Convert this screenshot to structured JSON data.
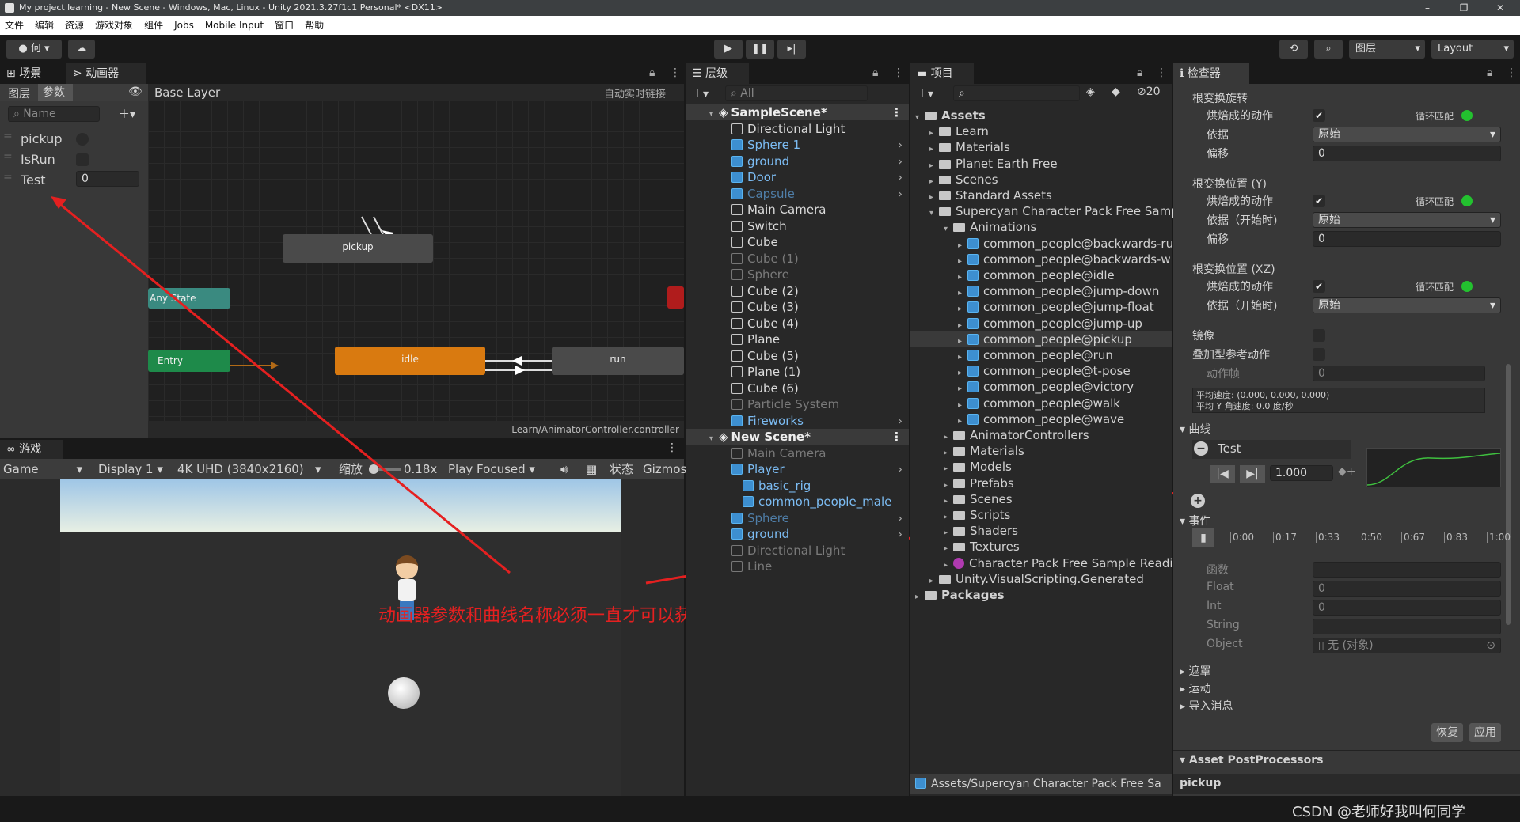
{
  "window": {
    "title": "My project learning - New Scene - Windows, Mac, Linux - Unity 2021.3.27f1c1 Personal* <DX11>"
  },
  "menu": [
    "文件",
    "编辑",
    "资源",
    "游戏对象",
    "组件",
    "Jobs",
    "Mobile Input",
    "窗口",
    "帮助"
  ],
  "toolbar": {
    "account": "何",
    "layers": "图层",
    "layout": "Layout"
  },
  "animator": {
    "tab_scene": "场景",
    "tab_animator": "动画器",
    "sub_layers": "图层",
    "sub_params": "参数",
    "breadcrumb": "Base Layer",
    "live_link": "自动实时链接",
    "search_placeholder": "Name",
    "params": [
      {
        "name": "pickup",
        "value": ""
      },
      {
        "name": "IsRun",
        "value": ""
      },
      {
        "name": "Test",
        "value": "0"
      }
    ],
    "nodes": {
      "pickup": "pickup",
      "any": "Any State",
      "entry": "Entry",
      "idle": "idle",
      "run": "run"
    },
    "footer": "Learn/AnimatorController.controller"
  },
  "game": {
    "tab": "游戏",
    "game": "Game",
    "display": "Display 1",
    "resolution": "4K UHD (3840x2160)",
    "scale_label": "缩放",
    "scale": "0.18x",
    "play_mode": "Play Focused",
    "stats": "状态",
    "gizmos": "Gizmos"
  },
  "annotation": "动画器参数和曲线名称必须一直才可以获取信息",
  "hierarchy": {
    "tab": "层级",
    "search_placeholder": "All",
    "scene1": "SampleScene*",
    "items1": [
      {
        "label": "Directional Light",
        "style": "white"
      },
      {
        "label": "Sphere 1",
        "style": "blue"
      },
      {
        "label": "ground",
        "style": "blue"
      },
      {
        "label": "Door",
        "style": "blue"
      },
      {
        "label": "Capsule",
        "style": "dimblue"
      },
      {
        "label": "Main Camera",
        "style": "white"
      },
      {
        "label": "Switch",
        "style": "white"
      },
      {
        "label": "Cube",
        "style": "white"
      },
      {
        "label": "Cube (1)",
        "style": "dim"
      },
      {
        "label": "Sphere",
        "style": "dim"
      },
      {
        "label": "Cube (2)",
        "style": "white"
      },
      {
        "label": "Cube (3)",
        "style": "white"
      },
      {
        "label": "Cube (4)",
        "style": "white"
      },
      {
        "label": "Plane",
        "style": "white"
      },
      {
        "label": "Cube (5)",
        "style": "white"
      },
      {
        "label": "Plane (1)",
        "style": "white"
      },
      {
        "label": "Cube (6)",
        "style": "white"
      },
      {
        "label": "Particle System",
        "style": "dim"
      },
      {
        "label": "Fireworks",
        "style": "blue"
      }
    ],
    "scene2": "New Scene*",
    "items2": [
      {
        "label": "Main Camera",
        "style": "dim"
      },
      {
        "label": "Player",
        "style": "blue"
      },
      {
        "label": "basic_rig",
        "style": "blue"
      },
      {
        "label": "common_people_male",
        "style": "blue"
      },
      {
        "label": "Sphere",
        "style": "dimblue"
      },
      {
        "label": "ground",
        "style": "blue"
      },
      {
        "label": "Directional Light",
        "style": "dim"
      },
      {
        "label": "Line",
        "style": "dim"
      }
    ]
  },
  "project": {
    "tab": "项目",
    "count": "20",
    "tree": [
      {
        "label": "Assets",
        "bold": true,
        "indent": 0,
        "kind": "folder"
      },
      {
        "label": "Learn",
        "indent": 1,
        "kind": "folder"
      },
      {
        "label": "Materials",
        "indent": 1,
        "kind": "folder"
      },
      {
        "label": "Planet Earth Free",
        "indent": 1,
        "kind": "folder"
      },
      {
        "label": "Scenes",
        "indent": 1,
        "kind": "folder"
      },
      {
        "label": "Standard Assets",
        "indent": 1,
        "kind": "folder"
      },
      {
        "label": "Supercyan Character Pack Free Samp",
        "indent": 1,
        "kind": "folder"
      },
      {
        "label": "Animations",
        "indent": 2,
        "kind": "folder"
      },
      {
        "label": "common_people@backwards-ru",
        "indent": 3,
        "kind": "anim"
      },
      {
        "label": "common_people@backwards-w",
        "indent": 3,
        "kind": "anim"
      },
      {
        "label": "common_people@idle",
        "indent": 3,
        "kind": "anim"
      },
      {
        "label": "common_people@jump-down",
        "indent": 3,
        "kind": "anim"
      },
      {
        "label": "common_people@jump-float",
        "indent": 3,
        "kind": "anim"
      },
      {
        "label": "common_people@jump-up",
        "indent": 3,
        "kind": "anim"
      },
      {
        "label": "common_people@pickup",
        "indent": 3,
        "kind": "anim",
        "selected": true
      },
      {
        "label": "common_people@run",
        "indent": 3,
        "kind": "anim"
      },
      {
        "label": "common_people@t-pose",
        "indent": 3,
        "kind": "anim"
      },
      {
        "label": "common_people@victory",
        "indent": 3,
        "kind": "anim"
      },
      {
        "label": "common_people@walk",
        "indent": 3,
        "kind": "anim"
      },
      {
        "label": "common_people@wave",
        "indent": 3,
        "kind": "anim"
      },
      {
        "label": "AnimatorControllers",
        "indent": 2,
        "kind": "folder"
      },
      {
        "label": "Materials",
        "indent": 2,
        "kind": "folder"
      },
      {
        "label": "Models",
        "indent": 2,
        "kind": "folder"
      },
      {
        "label": "Prefabs",
        "indent": 2,
        "kind": "folder"
      },
      {
        "label": "Scenes",
        "indent": 2,
        "kind": "folder"
      },
      {
        "label": "Scripts",
        "indent": 2,
        "kind": "folder"
      },
      {
        "label": "Shaders",
        "indent": 2,
        "kind": "folder"
      },
      {
        "label": "Textures",
        "indent": 2,
        "kind": "folder"
      },
      {
        "label": "Character Pack Free Sample Readi",
        "indent": 2,
        "kind": "doc"
      },
      {
        "label": "Unity.VisualScripting.Generated",
        "indent": 1,
        "kind": "folder"
      },
      {
        "label": "Packages",
        "bold": true,
        "indent": 0,
        "kind": "folder"
      }
    ],
    "footer": "Assets/Supercyan Character Pack Free Sa"
  },
  "inspector": {
    "tab": "检查器",
    "root_rot": "根变换旋转",
    "bake": "烘焙成的动作",
    "loop_match": "循环匹配",
    "based": "依据",
    "based_val": "原始",
    "offset": "偏移",
    "offset_val": "0",
    "root_y": "根变换位置 (Y)",
    "based_start": "依据（开始时)",
    "root_xz": "根变换位置 (XZ)",
    "mirror": "镜像",
    "additive": "叠加型参考动作",
    "frame": "动作帧",
    "frame_val": "0",
    "avg": "平均速度: (0.000, 0.000, 0.000)",
    "avg_y": "平均 Y 角速度: 0.0 度/秒",
    "curves": "曲线",
    "curve_name": "Test",
    "curve_val": "1.000",
    "events": "事件",
    "ticks": [
      "0:00",
      "0:17",
      "0:33",
      "0:50",
      "0:67",
      "0:83",
      "1:00"
    ],
    "func": "函数",
    "float": "Float",
    "float_val": "0",
    "int": "Int",
    "int_val": "0",
    "string": "String",
    "object": "Object",
    "object_val": "无 (对象)",
    "mask": "遮罩",
    "motion": "运动",
    "import_msg": "导入消息",
    "revert": "恢复",
    "apply": "应用",
    "postproc": "Asset PostProcessors",
    "preview": "pickup"
  },
  "watermark": "CSDN @老师好我叫何同学"
}
